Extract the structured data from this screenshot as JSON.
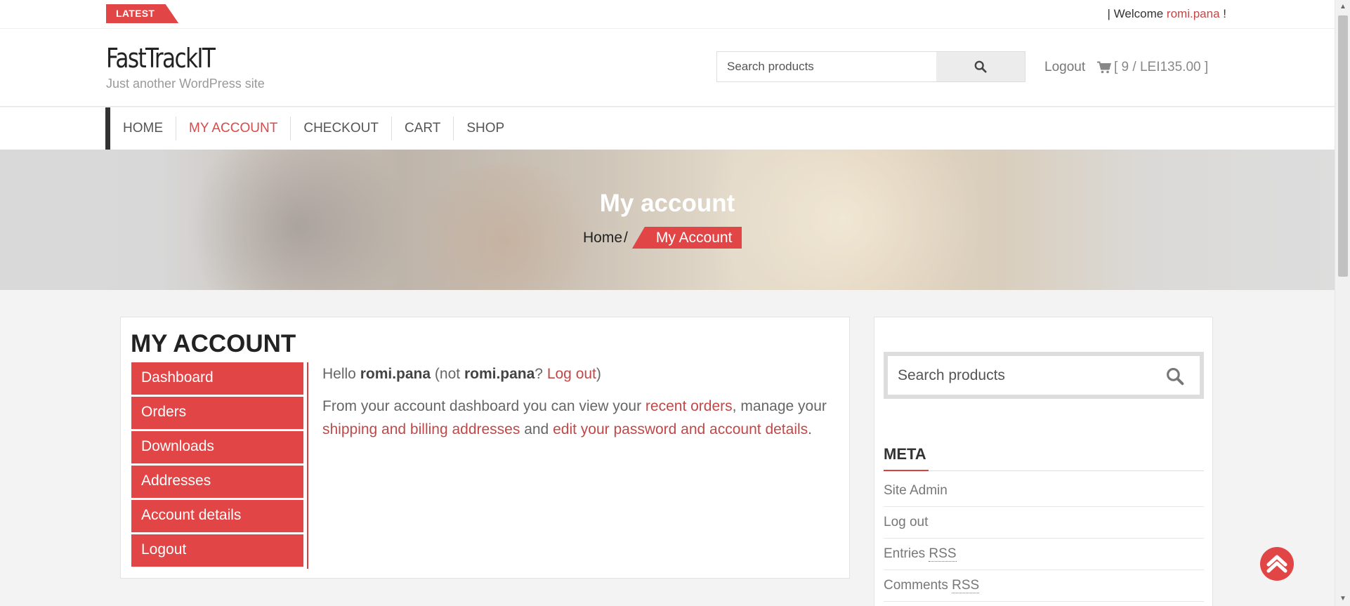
{
  "topbar": {
    "latest_label": "LATEST",
    "welcome_prefix": "| Welcome",
    "welcome_user": "romi.pana",
    "welcome_suffix": "!"
  },
  "header": {
    "site_title": "FastTrackIT",
    "tagline": "Just another WordPress site",
    "search_placeholder": "Search products",
    "logout_label": "Logout",
    "cart_text": "[ 9 / LEI135.00 ]"
  },
  "nav": {
    "items": [
      {
        "label": "HOME",
        "active": false
      },
      {
        "label": "MY ACCOUNT",
        "active": true
      },
      {
        "label": "CHECKOUT",
        "active": false
      },
      {
        "label": "CART",
        "active": false
      },
      {
        "label": "SHOP",
        "active": false
      }
    ]
  },
  "banner": {
    "title": "My account",
    "breadcrumb_home": "Home",
    "breadcrumb_sep": "/",
    "breadcrumb_current": "My Account"
  },
  "account": {
    "heading": "MY ACCOUNT",
    "menu": [
      "Dashboard",
      "Orders",
      "Downloads",
      "Addresses",
      "Account details",
      "Logout"
    ],
    "hello_prefix": "Hello",
    "username": "romi.pana",
    "not_prefix": "(not",
    "not_user": "romi.pana",
    "not_q": "?",
    "logout_link": "Log out",
    "close_paren": ")",
    "intro_1": "From your account dashboard you can view your",
    "link_orders": "recent orders",
    "intro_2": ", manage your",
    "link_addresses": "shipping and billing addresses",
    "intro_3": "and",
    "link_password": "edit your password and account details",
    "intro_4": "."
  },
  "sidebar": {
    "search_placeholder": "Search products",
    "meta_title": "META",
    "meta_items": [
      {
        "text": "Site Admin",
        "abbr": ""
      },
      {
        "text": "Log out",
        "abbr": ""
      },
      {
        "text": "Entries",
        "abbr": "RSS"
      },
      {
        "text": "Comments",
        "abbr": "RSS"
      }
    ]
  },
  "colors": {
    "accent": "#e24545",
    "link": "#c14848",
    "nav_bar": "#333333"
  },
  "icons": {
    "search": "search-icon",
    "cart": "cart-icon",
    "to_top": "chevron-up-icon"
  }
}
